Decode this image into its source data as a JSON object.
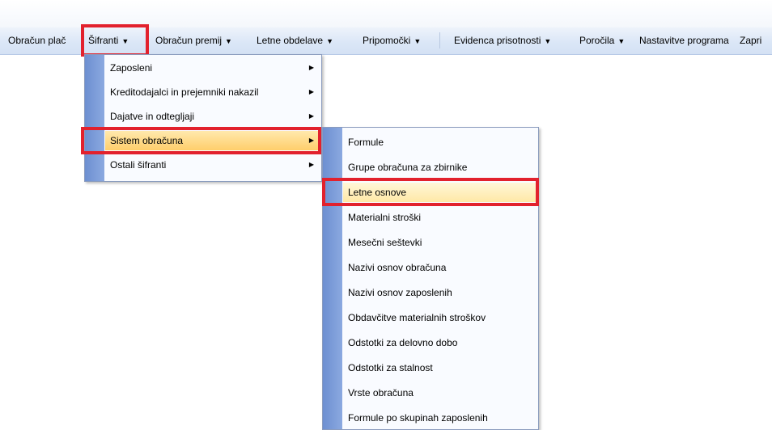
{
  "menubar": {
    "items": [
      {
        "label": "Obračun plač",
        "arrow": ""
      },
      {
        "label": "Šifranti",
        "arrow": "▼"
      },
      {
        "label": "Obračun premij",
        "arrow": "▼"
      },
      {
        "label": "Letne obdelave",
        "arrow": "▼"
      },
      {
        "label": "Pripomočki",
        "arrow": "▼"
      },
      {
        "label": "Evidenca prisotnosti",
        "arrow": "▼"
      },
      {
        "label": "Poročila",
        "arrow": "▼"
      },
      {
        "label": "Nastavitve programa",
        "arrow": ""
      },
      {
        "label": "Zapri",
        "arrow": ""
      }
    ]
  },
  "sifranti_menu": {
    "items": [
      {
        "label": "Zaposleni",
        "arrow": "▶"
      },
      {
        "label": "Kreditodajalci in prejemniki nakazil",
        "arrow": "▶"
      },
      {
        "label": "Dajatve in odtegljaji",
        "arrow": "▶"
      },
      {
        "label": "Sistem obračuna",
        "arrow": "▶"
      },
      {
        "label": "Ostali šifranti",
        "arrow": "▶"
      }
    ]
  },
  "sistem_menu": {
    "items": [
      {
        "label": "Formule"
      },
      {
        "label": "Grupe obračuna za zbirnike"
      },
      {
        "label": "Letne osnove"
      },
      {
        "label": "Materialni stroški"
      },
      {
        "label": "Mesečni seštevki"
      },
      {
        "label": "Nazivi osnov obračuna"
      },
      {
        "label": "Nazivi osnov zaposlenih"
      },
      {
        "label": "Obdavčitve materialnih stroškov"
      },
      {
        "label": "Odstotki za delovno dobo"
      },
      {
        "label": "Odstotki za stalnost"
      },
      {
        "label": "Vrste obračuna"
      },
      {
        "label": "Formule po skupinah zaposlenih"
      }
    ]
  },
  "colors": {
    "highlight": "#e2212d",
    "menu_gutter": "#6d8fd1",
    "hover": "#ffce6b"
  }
}
